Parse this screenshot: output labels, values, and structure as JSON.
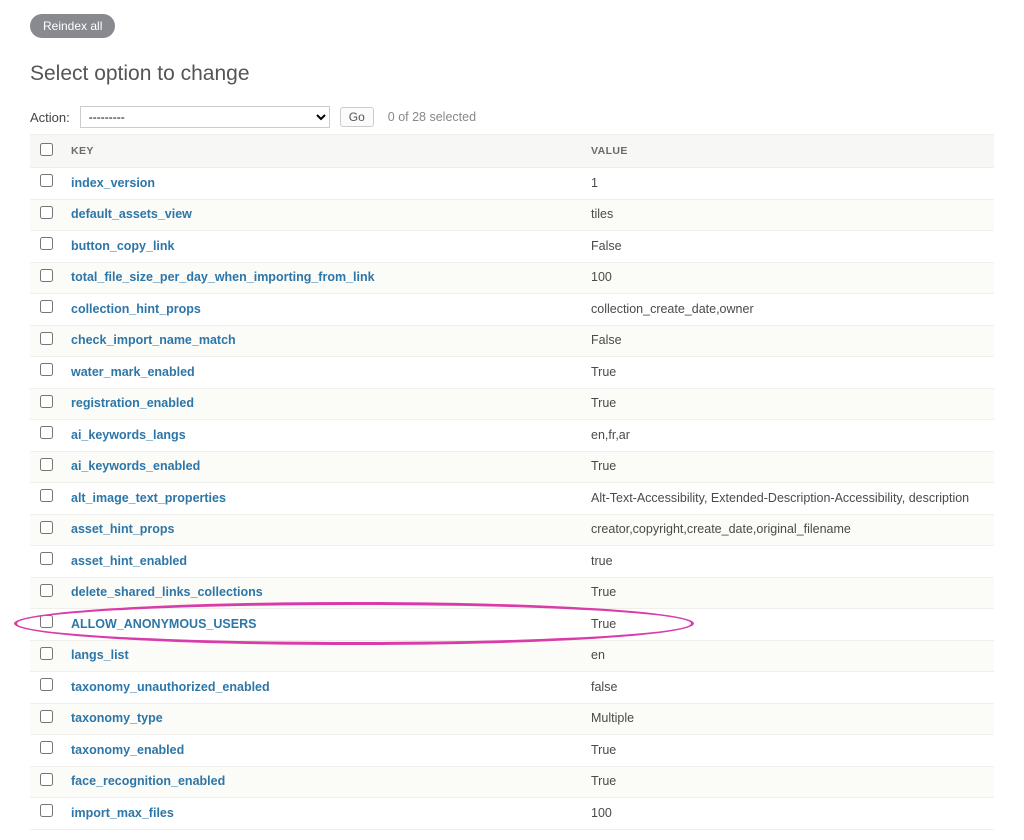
{
  "toolbar": {
    "reindex_label": "Reindex all"
  },
  "page_title": "Select option to change",
  "actions": {
    "label": "Action:",
    "placeholder": "---------",
    "go_label": "Go",
    "selected_text": "0 of 28 selected"
  },
  "table": {
    "headers": {
      "key": "KEY",
      "value": "VALUE"
    },
    "rows": [
      {
        "key": "index_version",
        "value": "1"
      },
      {
        "key": "default_assets_view",
        "value": "tiles"
      },
      {
        "key": "button_copy_link",
        "value": "False"
      },
      {
        "key": "total_file_size_per_day_when_importing_from_link",
        "value": "100"
      },
      {
        "key": "collection_hint_props",
        "value": "collection_create_date,owner"
      },
      {
        "key": "check_import_name_match",
        "value": "False"
      },
      {
        "key": "water_mark_enabled",
        "value": "True"
      },
      {
        "key": "registration_enabled",
        "value": "True"
      },
      {
        "key": "ai_keywords_langs",
        "value": "en,fr,ar"
      },
      {
        "key": "ai_keywords_enabled",
        "value": "True"
      },
      {
        "key": "alt_image_text_properties",
        "value": "Alt-Text-Accessibility, Extended-Description-Accessibility, description"
      },
      {
        "key": "asset_hint_props",
        "value": "creator,copyright,create_date,original_filename"
      },
      {
        "key": "asset_hint_enabled",
        "value": "true"
      },
      {
        "key": "delete_shared_links_collections",
        "value": "True"
      },
      {
        "key": "ALLOW_ANONYMOUS_USERS",
        "value": "True"
      },
      {
        "key": "langs_list",
        "value": "en"
      },
      {
        "key": "taxonomy_unauthorized_enabled",
        "value": "false"
      },
      {
        "key": "taxonomy_type",
        "value": "Multiple"
      },
      {
        "key": "taxonomy_enabled",
        "value": "True"
      },
      {
        "key": "face_recognition_enabled",
        "value": "True"
      },
      {
        "key": "import_max_files",
        "value": "100"
      }
    ]
  },
  "highlight_row_index": 14
}
